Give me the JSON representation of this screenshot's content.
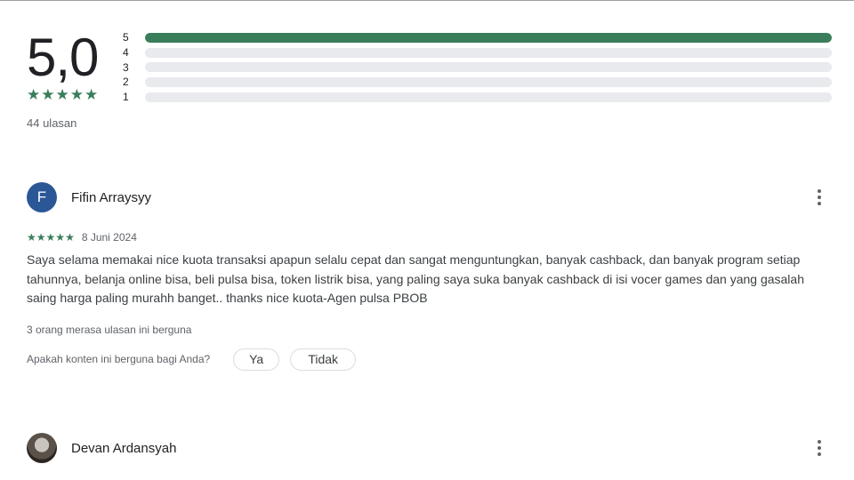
{
  "summary": {
    "score": "5,0",
    "review_count": "44 ulasan",
    "stars_filled": 5,
    "distribution": [
      {
        "label": "5",
        "fraction": 1.0
      },
      {
        "label": "4",
        "fraction": 0.0
      },
      {
        "label": "3",
        "fraction": 0.0
      },
      {
        "label": "2",
        "fraction": 0.0
      },
      {
        "label": "1",
        "fraction": 0.0
      }
    ]
  },
  "colors": {
    "accent_green": "#3a7d5a",
    "track_gray": "#e8eaed",
    "avatar_blue": "#2b5797"
  },
  "reviews": [
    {
      "avatar_letter": "F",
      "name": "Fifin Arraysyy",
      "date": "8 Juni 2024",
      "stars": 5,
      "text": "Saya selama memakai nice kuota transaksi apapun selalu cepat dan sangat menguntungkan, banyak cashback, dan banyak program setiap tahunnya, belanja online bisa, beli pulsa bisa, token listrik bisa, yang paling saya suka banyak cashback di isi vocer games dan yang gasalah saing harga paling murahh banget.. thanks nice kuota-Agen pulsa PBOB",
      "helpful": "3 orang merasa ulasan ini berguna",
      "ask": "Apakah konten ini berguna bagi Anda?",
      "yes_label": "Ya",
      "no_label": "Tidak"
    },
    {
      "avatar_letter": "",
      "name": "Devan Ardansyah"
    }
  ],
  "icons": {
    "star": "star-icon",
    "more": "more-vert-icon"
  }
}
